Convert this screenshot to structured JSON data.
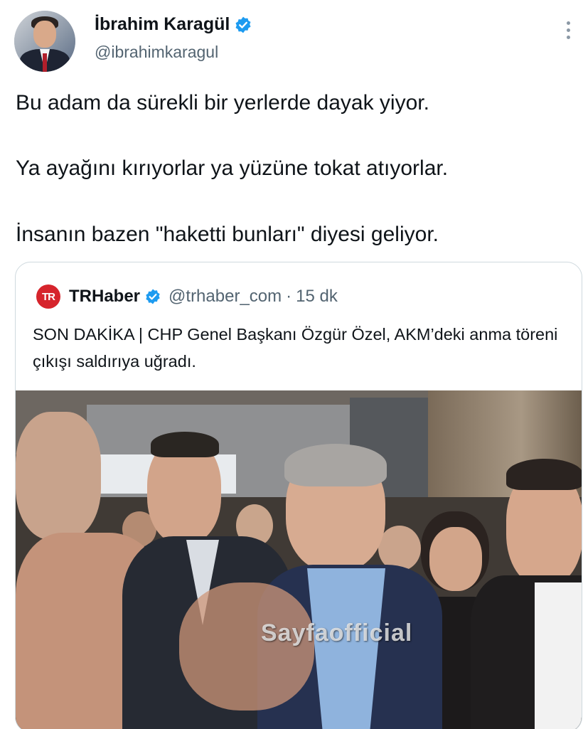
{
  "author": {
    "name": "İbrahim Karagül",
    "handle": "@ibrahimkaragul",
    "verified_icon": "verified-badge-icon",
    "more_icon": "more-options-icon"
  },
  "tweet": {
    "lines": [
      "Bu adam da sürekli bir yerlerde dayak yiyor.",
      "Ya ayağını kırıyorlar ya yüzüne tokat atıyorlar.",
      "İnsanın bazen \"haketti bunları\" diyesi geliyor."
    ]
  },
  "quote": {
    "logo_text": "TR",
    "name": "TRHaber",
    "handle": "@trhaber_com",
    "separator": "·",
    "time": "15 dk",
    "text": "SON DAKİKA | CHP Genel Başkanı Özgür Özel, AKM’deki anma töreni çıkışı saldırıya uğradı.",
    "media_watermark": "Sayfaofficial"
  },
  "colors": {
    "text": "#0f1419",
    "secondary": "#536471",
    "verified": "#1d9bf0",
    "border": "#cfd9de",
    "brand_red": "#d6242c"
  }
}
